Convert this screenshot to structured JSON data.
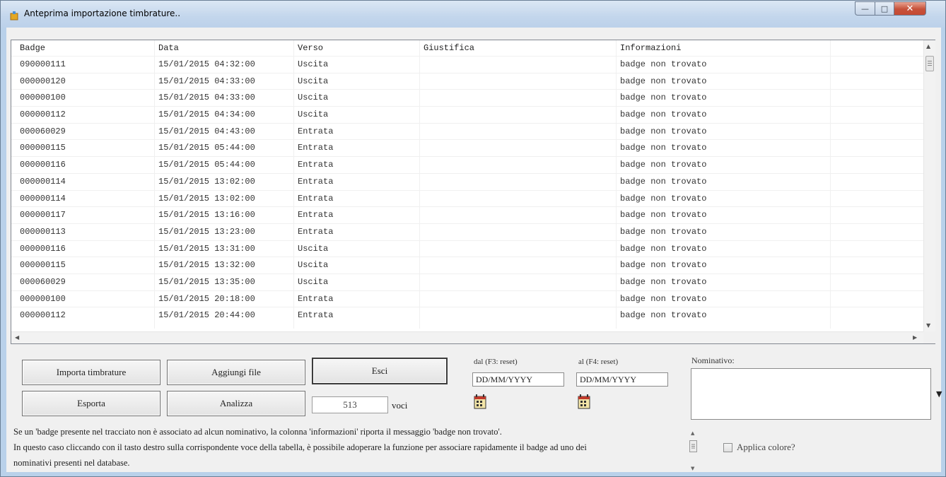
{
  "window": {
    "title": "Anteprima importazione timbrature..",
    "min_glyph": "—",
    "max_glyph": "□",
    "close_glyph": "✕"
  },
  "grid": {
    "columns": [
      "Badge",
      "Data",
      "Verso",
      "Giustifica",
      "Informazioni"
    ],
    "rows": [
      [
        "090000111",
        "15/01/2015 04:32:00",
        "Uscita",
        "",
        "badge non trovato"
      ],
      [
        "000000120",
        "15/01/2015 04:33:00",
        "Uscita",
        "",
        "badge non trovato"
      ],
      [
        "000000100",
        "15/01/2015 04:33:00",
        "Uscita",
        "",
        "badge non trovato"
      ],
      [
        "000000112",
        "15/01/2015 04:34:00",
        "Uscita",
        "",
        "badge non trovato"
      ],
      [
        "000060029",
        "15/01/2015 04:43:00",
        "Entrata",
        "",
        "badge non trovato"
      ],
      [
        "000000115",
        "15/01/2015 05:44:00",
        "Entrata",
        "",
        "badge non trovato"
      ],
      [
        "000000116",
        "15/01/2015 05:44:00",
        "Entrata",
        "",
        "badge non trovato"
      ],
      [
        "000000114",
        "15/01/2015 13:02:00",
        "Entrata",
        "",
        "badge non trovato"
      ],
      [
        "000000114",
        "15/01/2015 13:02:00",
        "Entrata",
        "",
        "badge non trovato"
      ],
      [
        "000000117",
        "15/01/2015 13:16:00",
        "Entrata",
        "",
        "badge non trovato"
      ],
      [
        "000000113",
        "15/01/2015 13:23:00",
        "Entrata",
        "",
        "badge non trovato"
      ],
      [
        "000000116",
        "15/01/2015 13:31:00",
        "Uscita",
        "",
        "badge non trovato"
      ],
      [
        "000000115",
        "15/01/2015 13:32:00",
        "Uscita",
        "",
        "badge non trovato"
      ],
      [
        "000060029",
        "15/01/2015 13:35:00",
        "Uscita",
        "",
        "badge non trovato"
      ],
      [
        "000000100",
        "15/01/2015 20:18:00",
        "Entrata",
        "",
        "badge non trovato"
      ],
      [
        "000000112",
        "15/01/2015 20:44:00",
        "Entrata",
        "",
        "badge non trovato"
      ]
    ]
  },
  "buttons": {
    "importa": "Importa timbrature",
    "aggiungi": "Aggiungi file",
    "esci": "Esci",
    "esporta": "Esporta",
    "analizza": "Analizza"
  },
  "voci": {
    "count": "513",
    "label": "voci"
  },
  "filters": {
    "dal_label": "dal (F3: reset)",
    "al_label": "al (F4: reset)",
    "dal_value": "DD/MM/YYYY",
    "al_value": "DD/MM/YYYY"
  },
  "nominativo": {
    "label": "Nominativo:",
    "dropdown_glyph": "▼"
  },
  "info": {
    "line1": "Se un 'badge presente nel tracciato non è associato ad alcun nominativo, la colonna 'informazioni' riporta il messaggio 'badge non trovato'.",
    "line2": "In questo caso cliccando con il tasto destro sulla corrispondente voce della tabella, è possibile adoperare la funzione per associare rapidamente il badge ad uno dei",
    "line3": "nominativi presenti nel database."
  },
  "applica_colore": {
    "label": "Applica colore?",
    "checked": false
  }
}
